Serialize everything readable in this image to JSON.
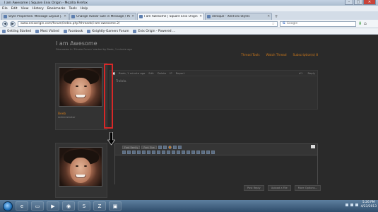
{
  "window": {
    "title": "I am Awesome | Square Enix Origin - Mozilla Firefox",
    "min": "–",
    "max": "□",
    "close": "✕"
  },
  "menu": [
    "File",
    "Edit",
    "View",
    "History",
    "Bookmarks",
    "Tools",
    "Help"
  ],
  "tabs": [
    {
      "label": "Style Properties: Message Layout | Ad...",
      "active": false
    },
    {
      "label": "Change Avatar Size in Message / Post...",
      "active": false
    },
    {
      "label": "I am Awesome | Square Enix Origin",
      "active": true
    },
    {
      "label": "Xenique - XenForo Styles",
      "active": false
    }
  ],
  "nav": {
    "back": "◀",
    "forward": "▶",
    "url": "www.enixorigin.com/forum/index.php?threads/i-am-awesome.2/",
    "search_engine": "G",
    "search_placeholder": "Google"
  },
  "bookmarks": [
    "Getting Started",
    "Most Visited",
    "Facebook",
    "Knightly-Gamers Forum",
    "Enix Origin - Powered ..."
  ],
  "page": {
    "title": "I am Awesome",
    "subtitle": "Discussion in 'Private Forum' started by Beeb, 1 minute ago",
    "thread_tools": [
      "Thread Tools",
      "Watch Thread",
      "Subscription(s) 8"
    ]
  },
  "post": {
    "username": "Beeb",
    "user_title": "Administrator",
    "meta": "Beeb, 1 minute ago",
    "actions": [
      "Edit",
      "Delete",
      "IP",
      "Report"
    ],
    "number": "#1",
    "reply": "Reply",
    "text": "Trololo."
  },
  "editor": {
    "font_family": "Font Family",
    "font_size": "Font Size",
    "buttons": [
      "Post Reply",
      "Upload a File",
      "More Options..."
    ]
  },
  "taskbar": {
    "time": "5:26 PM",
    "date": "4/23/2013"
  },
  "colors": {
    "accent": "#d07a1a",
    "highlight": "#d62828"
  }
}
